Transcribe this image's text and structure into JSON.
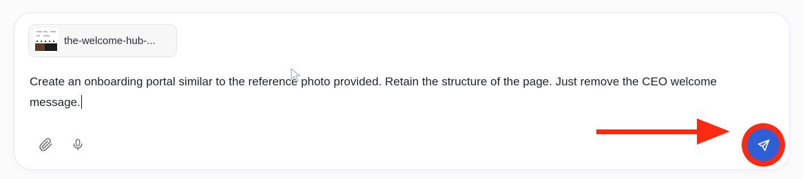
{
  "composer": {
    "attachment": {
      "filename": "the-welcome-hub-...",
      "thumbnail_icon": "image-thumbnail-icon"
    },
    "prompt_text": "Create an onboarding portal similar to the reference photo provided. Retain the structure of the page. Just remove the CEO welcome message.",
    "toolbar": {
      "attach_icon": "paperclip-icon",
      "mic_icon": "microphone-icon"
    },
    "send": {
      "icon": "send-icon",
      "button_color": "#2f5fd6",
      "highlight_color": "#ff2a12"
    }
  },
  "annotation": {
    "arrow_color": "#ff2a12"
  }
}
